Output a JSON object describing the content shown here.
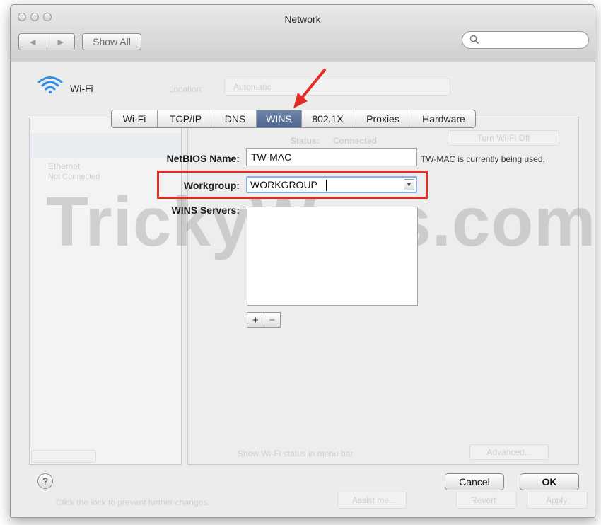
{
  "window": {
    "title": "Network"
  },
  "toolbar": {
    "show_all_label": "Show All",
    "search_placeholder": ""
  },
  "interface": {
    "name": "Wi-Fi"
  },
  "background_faded": {
    "location_label": "Location:",
    "location_value": "Automatic",
    "status_label": "Status:",
    "status_value": "Connected",
    "turn_off_label": "Turn Wi-Fi Off",
    "sidebar_item_1_name": "Ethernet",
    "sidebar_item_1_status": "Not Connected",
    "show_menu_bar_label": "Show Wi-Fi status in menu bar",
    "advanced_label": "Advanced...",
    "lock_text": "Click the lock to prevent further changes.",
    "assist_label": "Assist me...",
    "revert_label": "Revert",
    "apply_label": "Apply"
  },
  "tabs": [
    {
      "label": "Wi-Fi"
    },
    {
      "label": "TCP/IP"
    },
    {
      "label": "DNS"
    },
    {
      "label": "WINS"
    },
    {
      "label": "802.1X"
    },
    {
      "label": "Proxies"
    },
    {
      "label": "Hardware"
    }
  ],
  "active_tab": "WINS",
  "form": {
    "netbios_label": "NetBIOS Name:",
    "netbios_value": "TW-MAC",
    "netbios_note": "TW-MAC is currently being used.",
    "workgroup_label": "Workgroup:",
    "workgroup_value": "WORKGROUP",
    "wins_servers_label": "WINS Servers:",
    "wins_servers": []
  },
  "list_controls": {
    "add_label": "+",
    "remove_label": "−"
  },
  "watermark": "TrickyWays.com",
  "footer": {
    "help_label": "?",
    "cancel_label": "Cancel",
    "ok_label": "OK"
  },
  "colors": {
    "highlight_border": "#e32d24",
    "arrow": "#e32d24",
    "active_tab": "#5a72a0",
    "wifi_icon": "#2f8ee8"
  }
}
